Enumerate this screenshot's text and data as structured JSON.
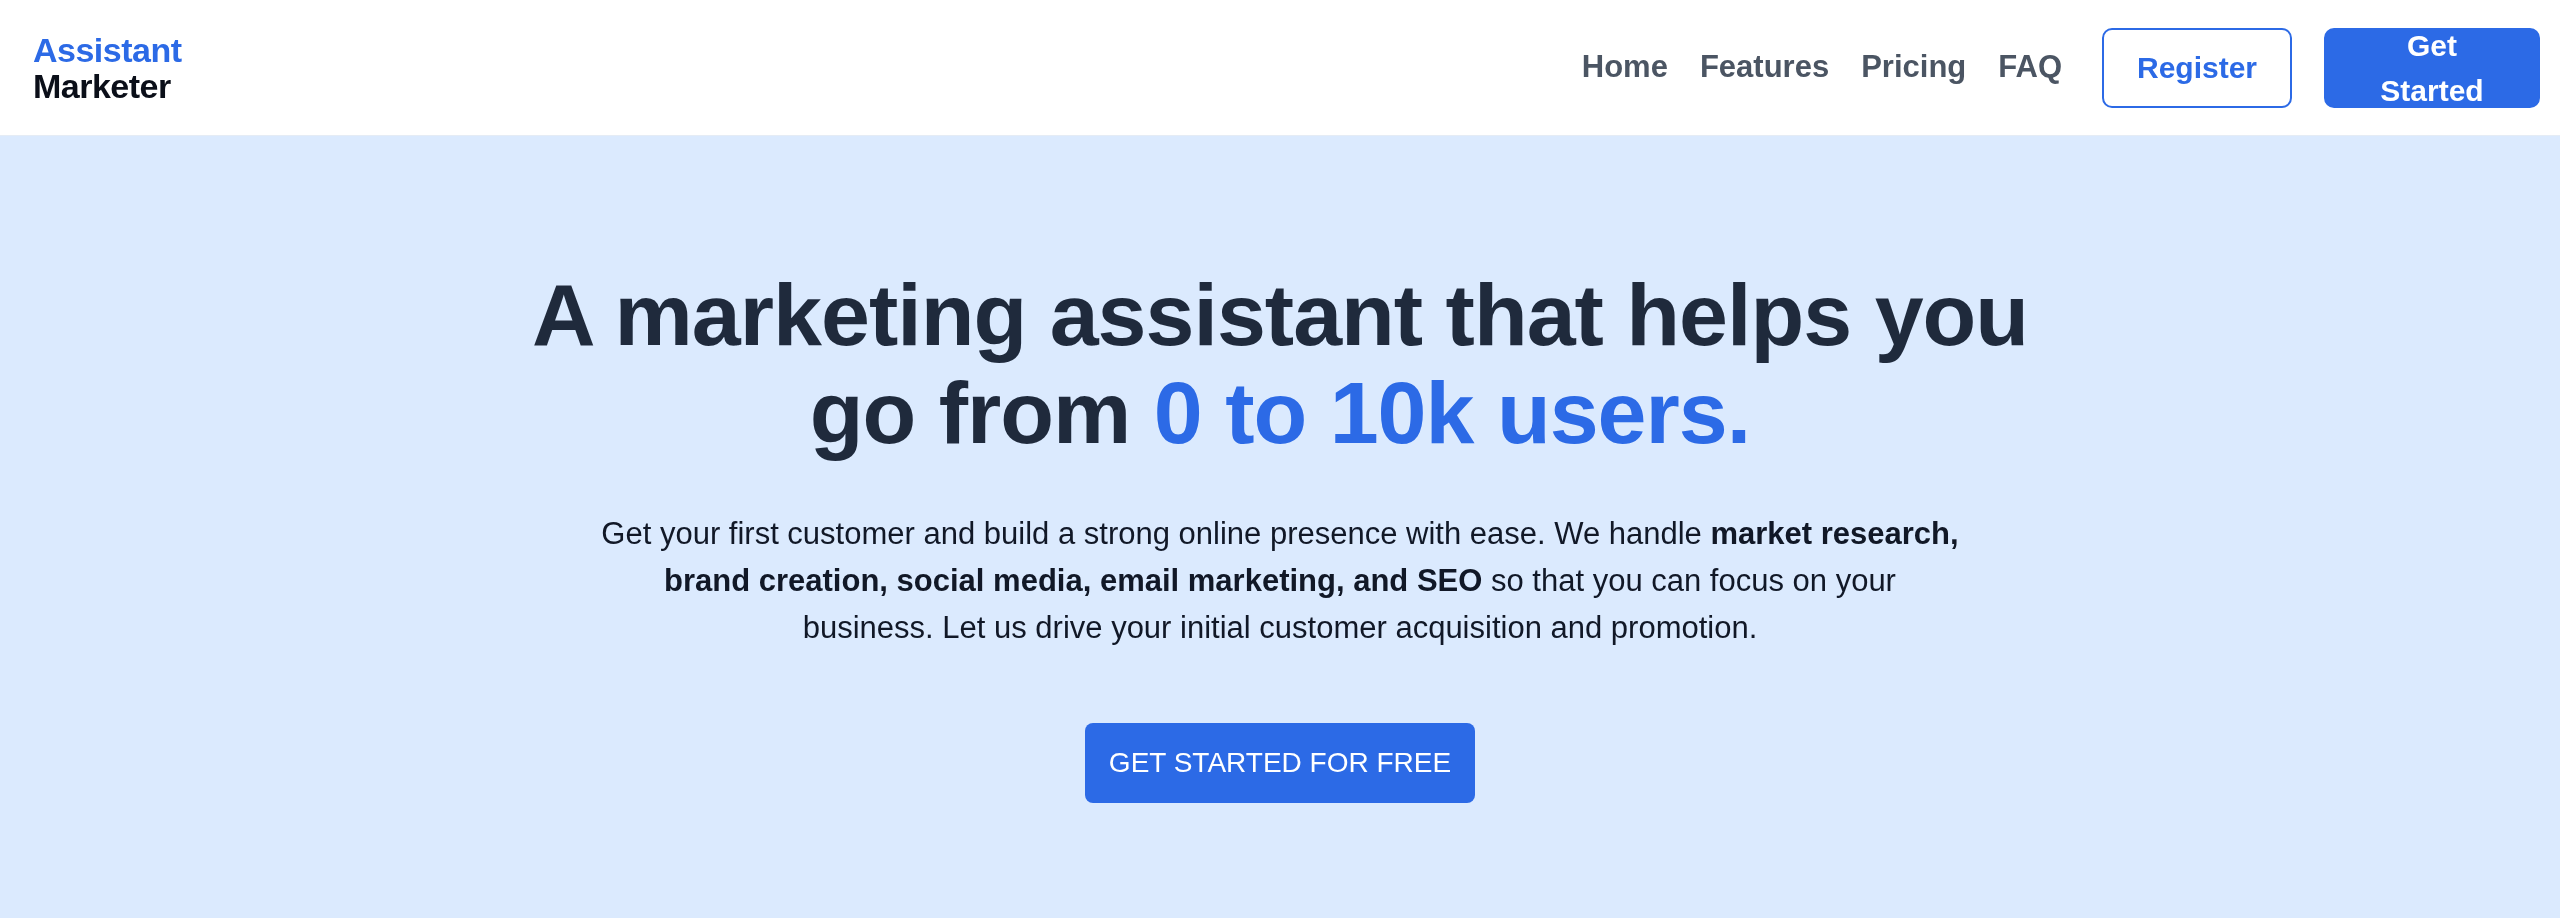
{
  "logo": {
    "line_1": "Assistant",
    "line_2": "Marketer"
  },
  "nav": {
    "links": [
      "Home",
      "Features",
      "Pricing",
      "FAQ"
    ],
    "buttons": [
      {
        "label": "Register",
        "kind": "outline"
      },
      {
        "label": "Get Started",
        "kind": "solid"
      }
    ]
  },
  "hero": {
    "headline": "A marketing assistant that helps you go from ",
    "headline_highlight": "0 to 10k users.",
    "text": "Get your first customer and build a strong online presence with ease. We handle **market research, brand creation, social media, email marketing, and SEO** so that you can focus on your business. Let us drive your initial customer acquisition and promotion.",
    "cta": "GET STARTED FOR FREE"
  }
}
